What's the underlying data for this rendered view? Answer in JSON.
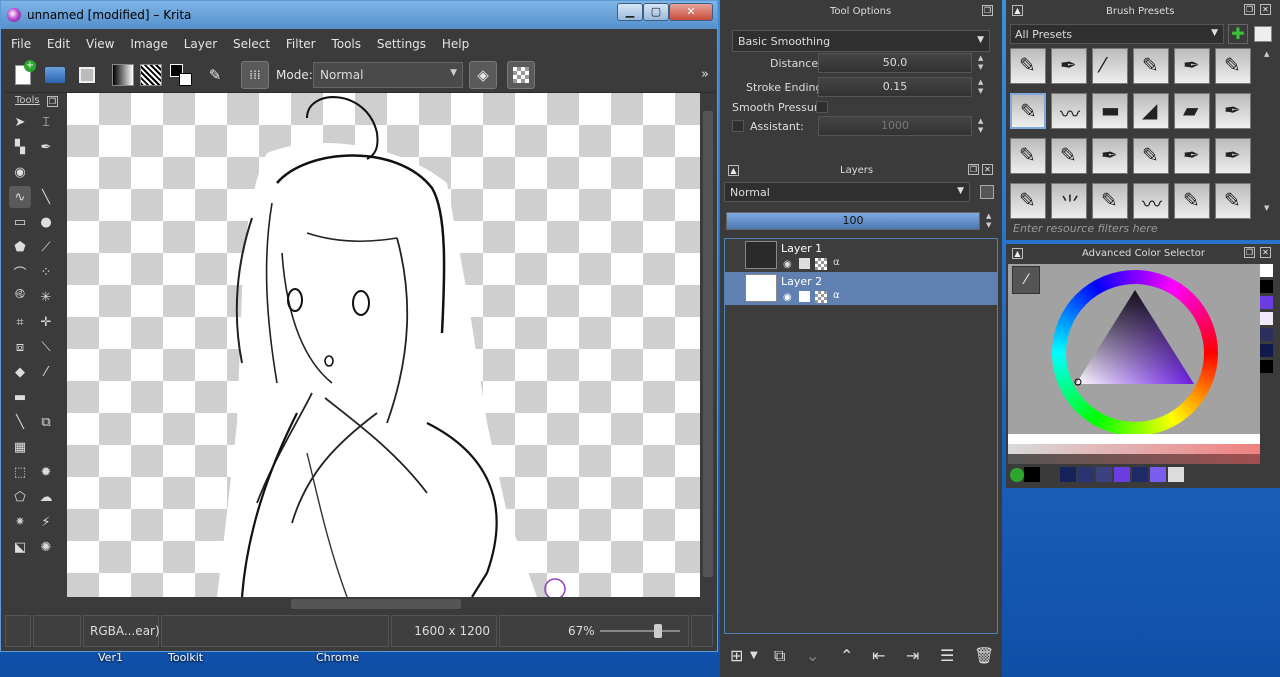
{
  "window": {
    "title": "unnamed [modified] – Krita"
  },
  "menu": [
    "File",
    "Edit",
    "View",
    "Image",
    "Layer",
    "Select",
    "Filter",
    "Tools",
    "Settings",
    "Help"
  ],
  "toolbar": {
    "mode_label": "Mode:",
    "mode_value": "Normal",
    "overflow": "»"
  },
  "toolbox": {
    "title": "Tools"
  },
  "status": {
    "color_space": "RGBA...ear)",
    "size": "1600 x 1200",
    "zoom": "67%",
    "zoom_fraction": 0.67
  },
  "tool_options": {
    "title": "Tool Options",
    "smoothing": "Basic Smoothing",
    "distance_label": "Distance:",
    "distance_value": "50.0",
    "stroke_label": "Stroke Ending:",
    "stroke_value": "0.15",
    "pressure_label": "Smooth Pressure",
    "assistant_label": "Assistant:",
    "assistant_value": "1000"
  },
  "layers": {
    "title": "Layers",
    "blend": "Normal",
    "opacity": "100",
    "items": [
      {
        "name": "Layer 1",
        "selected": false
      },
      {
        "name": "Layer 2",
        "selected": true
      }
    ]
  },
  "brush_presets": {
    "title": "Brush Presets",
    "filter": "All Presets",
    "search_placeholder": "Enter resource filters here"
  },
  "color_selector": {
    "title": "Advanced Color Selector"
  },
  "taskbar": {
    "items": [
      "Ver1",
      "Toolkit",
      "Chrome"
    ]
  },
  "colors": {
    "accent": "#5f80b0",
    "desktop": "#1f6fc0",
    "panel": "#3b3b3b"
  }
}
